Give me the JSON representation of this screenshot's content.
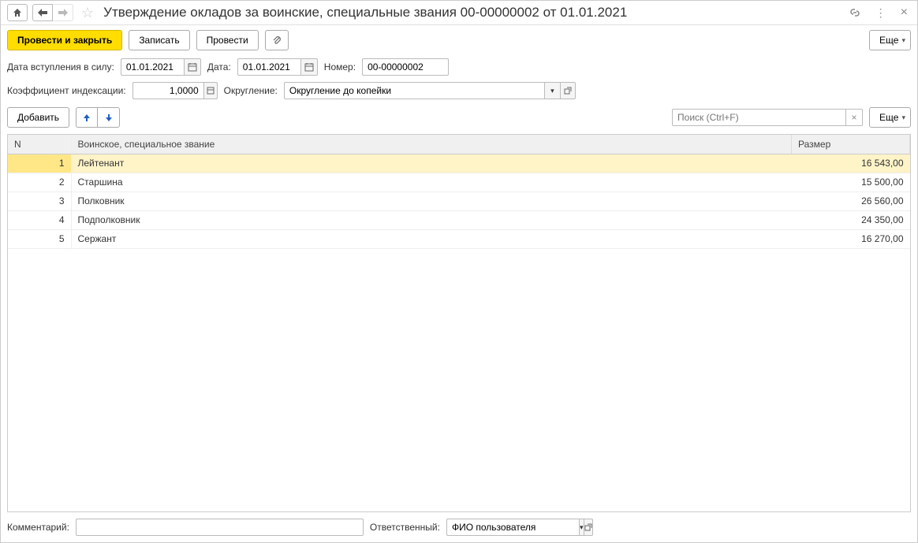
{
  "header": {
    "title": "Утверждение окладов за воинские, специальные звания 00-00000002 от 01.01.2021"
  },
  "toolbar": {
    "post_close": "Провести и закрыть",
    "save": "Записать",
    "post": "Провести",
    "more": "Еще"
  },
  "form": {
    "effective_label": "Дата вступления в силу:",
    "effective_date": "01.01.2021",
    "date_label": "Дата:",
    "date": "01.01.2021",
    "number_label": "Номер:",
    "number": "00-00000002",
    "coef_label": "Коэффициент индексации:",
    "coef": "1,0000",
    "rounding_label": "Округление:",
    "rounding": "Округление до копейки"
  },
  "table_toolbar": {
    "add": "Добавить",
    "search_placeholder": "Поиск (Ctrl+F)",
    "more": "Еще"
  },
  "table": {
    "columns": {
      "n": "N",
      "title": "Воинское, специальное звание",
      "size": "Размер"
    },
    "rows": [
      {
        "n": "1",
        "title": "Лейтенант",
        "size": "16 543,00"
      },
      {
        "n": "2",
        "title": "Старшина",
        "size": "15 500,00"
      },
      {
        "n": "3",
        "title": "Полковник",
        "size": "26 560,00"
      },
      {
        "n": "4",
        "title": "Подполковник",
        "size": "24 350,00"
      },
      {
        "n": "5",
        "title": "Сержант",
        "size": "16 270,00"
      }
    ]
  },
  "footer": {
    "comment_label": "Комментарий:",
    "comment": "",
    "responsible_label": "Ответственный:",
    "responsible": "ФИО пользователя"
  }
}
